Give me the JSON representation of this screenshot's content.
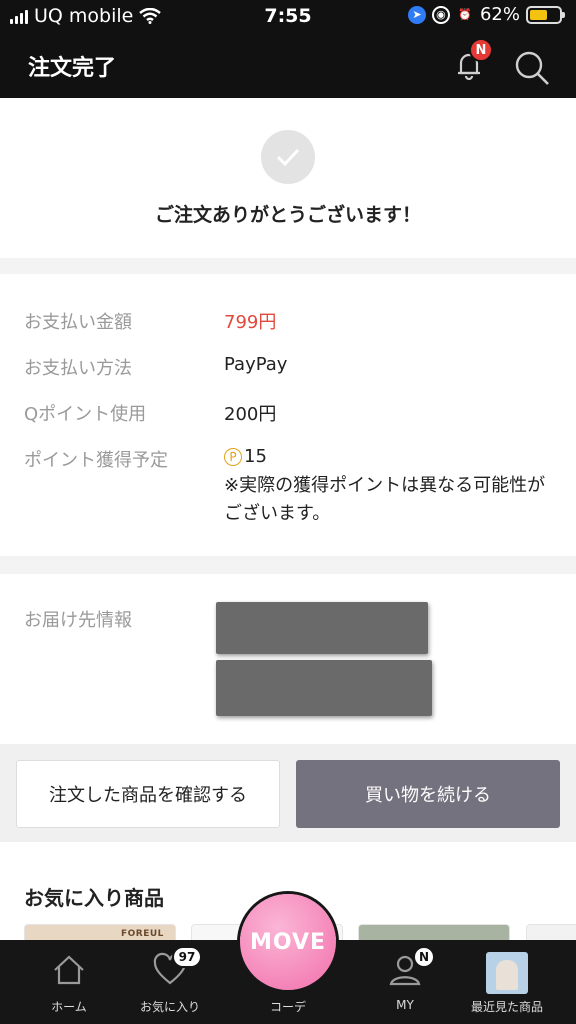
{
  "status_bar": {
    "carrier": "UQ mobile",
    "time": "7:55",
    "battery": "62%",
    "battery_level": 0.62
  },
  "header": {
    "title": "注文完了",
    "notification_badge": "N"
  },
  "confirmation": {
    "message": "ご注文ありがとうございます！"
  },
  "payment": {
    "amount_label": "お支払い金額",
    "amount_value": "799円",
    "method_label": "お支払い方法",
    "method_value": "PayPay",
    "qpoint_label": "Qポイント使用",
    "qpoint_value": "200円",
    "points_label": "ポイント獲得予定",
    "points_symbol": "P",
    "points_value": "15",
    "points_note": "※実際の獲得ポイントは異なる可能性がございます。"
  },
  "delivery": {
    "label": "お届け先情報"
  },
  "actions": {
    "check_order_label": "注文した商品を確認する",
    "continue_shopping_label": "買い物を続ける"
  },
  "favorites": {
    "title": "お気に入り商品",
    "thumb_brand": "FOREUL"
  },
  "tab_bar": {
    "home": "ホーム",
    "favorites": "お気に入り",
    "favorites_count": "97",
    "center_logo": "MOVE",
    "coordinate": "コーデ",
    "my": "MY",
    "my_badge": "N",
    "recent": "最近見た商品"
  },
  "colors": {
    "price_red": "#e2483d",
    "point_orange": "#e2a21b",
    "primary_button": "#74727e",
    "move_pink": "#f16fab"
  }
}
